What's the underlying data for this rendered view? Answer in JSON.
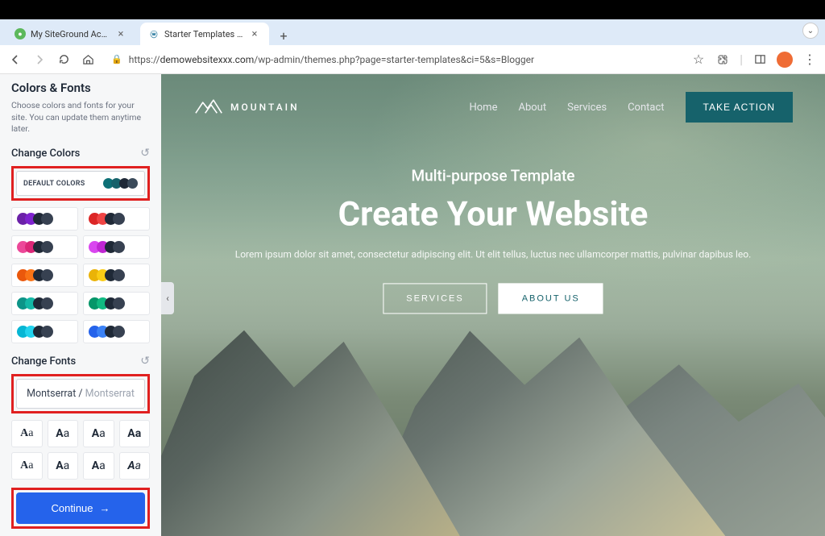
{
  "browser": {
    "tabs": [
      {
        "title": "My SiteGround Account",
        "favicon": "sg"
      },
      {
        "title": "Starter Templates ‹ My WordP",
        "favicon": "wp"
      }
    ],
    "url_prefix": "https://",
    "url_host": "demowebsitexxx.com",
    "url_path": "/wp-admin/themes.php?page=starter-templates&ci=5&s=Blogger"
  },
  "sidebar": {
    "heading": "Colors & Fonts",
    "description": "Choose colors and fonts for your site. You can update them anytime later.",
    "change_colors_label": "Change Colors",
    "default_colors_label": "DEFAULT COLORS",
    "default_swatches": [
      "#0d7076",
      "#16626b",
      "#1f2937",
      "#3a4a5a"
    ],
    "palettes": [
      [
        "#6b21a8",
        "#7e22ce",
        "#1f2937",
        "#374151"
      ],
      [
        "#dc2626",
        "#ef4444",
        "#1f2937",
        "#374151"
      ],
      [
        "#ec4899",
        "#db2777",
        "#1f2937",
        "#374151"
      ],
      [
        "#d946ef",
        "#c026d3",
        "#1f2937",
        "#374151"
      ],
      [
        "#ea580c",
        "#f97316",
        "#1f2937",
        "#374151"
      ],
      [
        "#eab308",
        "#facc15",
        "#1f2937",
        "#374151"
      ],
      [
        "#0d9488",
        "#14b8a6",
        "#1f2937",
        "#374151"
      ],
      [
        "#059669",
        "#10b981",
        "#1f2937",
        "#374151"
      ],
      [
        "#06b6d4",
        "#22d3ee",
        "#1f2937",
        "#374151"
      ],
      [
        "#2563eb",
        "#3b82f6",
        "#1f2937",
        "#374151"
      ]
    ],
    "change_fonts_label": "Change Fonts",
    "selected_font_primary": "Montserrat",
    "selected_font_secondary": "Montserrat",
    "font_sample": "Aa",
    "continue_label": "Continue"
  },
  "preview": {
    "logo_text": "MOUNTAIN",
    "nav": [
      "Home",
      "About",
      "Services",
      "Contact"
    ],
    "cta": "TAKE ACTION",
    "hero_subtitle": "Multi-purpose Template",
    "hero_title": "Create Your Website",
    "hero_desc": "Lorem ipsum dolor sit amet, consectetur adipiscing elit. Ut elit tellus, luctus nec ullamcorper mattis, pulvinar dapibus leo.",
    "btn_services": "SERVICES",
    "btn_about": "ABOUT US"
  }
}
